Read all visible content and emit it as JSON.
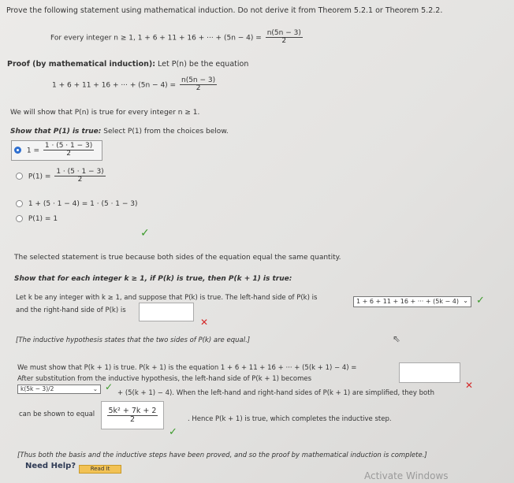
{
  "prompt": "Prove the following statement using mathematical induction. Do not derive it from Theorem 5.2.1 or Theorem 5.2.2.",
  "statement": {
    "lead": "For every integer n ≥ 1, 1 + 6 + 11 + 16 + ··· + (5n − 4) =",
    "num": "n(5n − 3)",
    "den": "2"
  },
  "proof_heading": "Proof (by mathematical induction):",
  "proof_let": "Let P(n) be the equation",
  "pn_equation": {
    "lhs": "1 + 6 + 11 + 16 + ··· + (5n − 4) =",
    "num": "n(5n − 3)",
    "den": "2"
  },
  "we_will_show": "We will show that P(n) is true for every integer n ≥ 1.",
  "show_p1_label": "Show that P(1) is true:",
  "show_p1_instruction": "Select P(1) from the choices below.",
  "choices": {
    "c1": {
      "lhs": "1 =",
      "num": "1 · (5 · 1 − 3)",
      "den": "2"
    },
    "c2": {
      "lhs": "P(1) =",
      "num": "1 · (5 · 1 − 3)",
      "den": "2"
    },
    "c3": {
      "text": "1 + (5 · 1 − 4) = 1 · (5 · 1 − 3)"
    },
    "c4": {
      "text": "P(1) = 1"
    }
  },
  "selected_reason": "The selected statement is true because both sides of the equation equal the same quantity.",
  "show_inductive_label": "Show that for each integer k ≥ 1, if P(k) is true, then P(k + 1) is true:",
  "let_k_text": "Let k be any integer with k ≥ 1, and suppose that P(k) is true. The left-hand side of P(k) is",
  "lhs_pk_select": "1 + 6 + 11 + 16 + ··· + (5k − 4)",
  "rhs_pk_text": "and the right-hand side of P(k) is",
  "ih_note": "[The inductive hypothesis states that the two sides of P(k) are equal.]",
  "must_show_text": "We must show that P(k + 1) is true. P(k + 1) is the equation 1 + 6 + 11 + 16 + ··· + (5(k + 1) − 4) =",
  "after_sub_text": "After substitution from the inductive hypothesis, the left-hand side of P(k + 1) becomes",
  "sub_select": "k(5k − 3)/2",
  "plus_text": "+ (5(k + 1) − 4). When the left-hand and right-hand sides of P(k + 1) are simplified, they both",
  "shown_equal_text": "can be shown to equal",
  "simplified": {
    "num": "5k² + 7k + 2",
    "den": "2"
  },
  "hence_text": ". Hence P(k + 1) is true, which completes the inductive step.",
  "thus_note": "[Thus both the basis and the inductive steps have been proved, and so the proof by mathematical induction is complete.]",
  "need_help": "Need Help?",
  "read_it": "Read It",
  "watermark": "Activate Windows",
  "colors": {
    "check": "#3a9a2a",
    "cross": "#d32a2a",
    "radio_selected": "#2e6fd0",
    "button": "#f2c255"
  }
}
